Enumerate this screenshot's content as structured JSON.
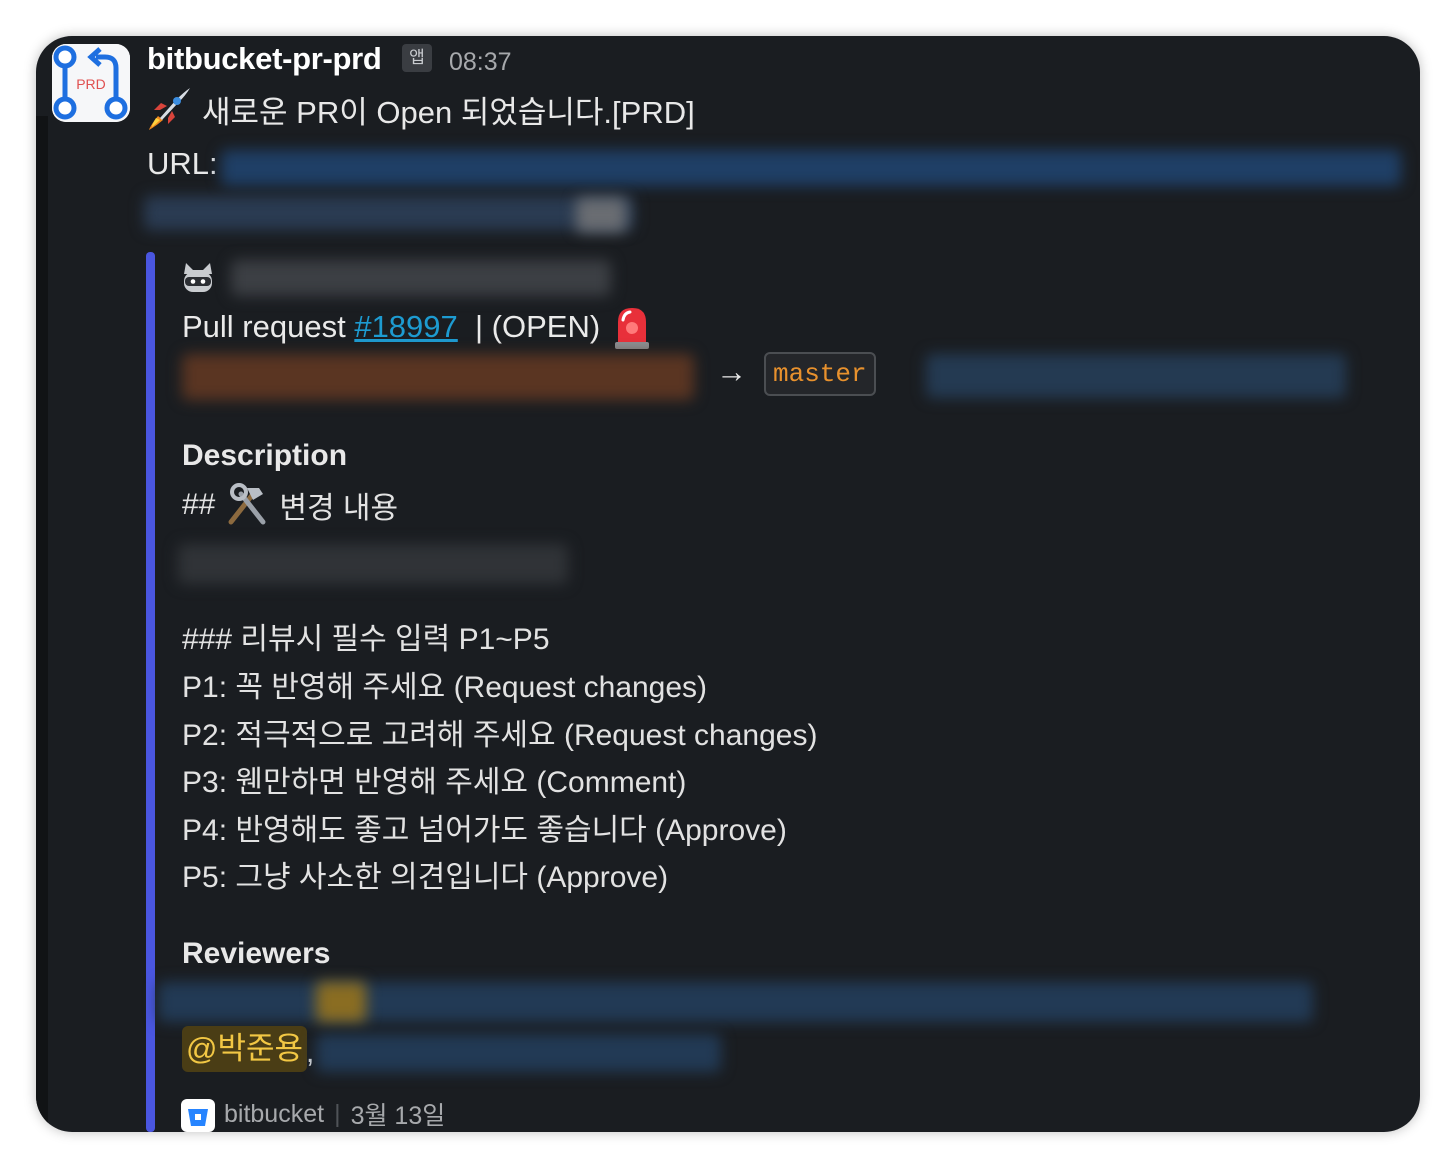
{
  "message": {
    "sender": "bitbucket-pr-prd",
    "app_badge": "앱",
    "time": "08:37",
    "avatar_label": "PRD",
    "title": "새로운 PR이 Open 되었습니다.[PRD]",
    "url_label": "URL:"
  },
  "attachment": {
    "pr_prefix": "Pull request ",
    "pr_number": "#18997",
    "pr_status": "  | (OPEN)",
    "arrow": "→",
    "target_branch": "master",
    "description_heading": "Description",
    "description_title": "변경 내용",
    "description_hash": "##",
    "review_guide": [
      "### 리뷰시 필수 입력 P1~P5",
      "P1: 꼭 반영해 주세요 (Request changes)",
      "P2: 적극적으로 고려해 주세요 (Request changes)",
      "P3: 웬만하면 반영해 주세요 (Comment)",
      "P4: 반영해도 좋고 넘어가도 좋습니다 (Approve)",
      "P5: 그냥 사소한 의견입니다 (Approve)"
    ],
    "reviewers_heading": "Reviewers",
    "mention": "@박준용",
    "mention_comma": ",",
    "footer_app": "bitbucket",
    "footer_date": "3월 13일"
  },
  "colors": {
    "background": "#1a1d21",
    "accent_bar": "#4a56e0",
    "link": "#1d9bd1",
    "branch_text": "#e8912d",
    "mention_text": "#f2c744"
  },
  "icons": [
    "pull-request-icon",
    "rocket-icon",
    "ninja-cat-icon",
    "siren-icon",
    "tools-icon",
    "bitbucket-icon"
  ]
}
